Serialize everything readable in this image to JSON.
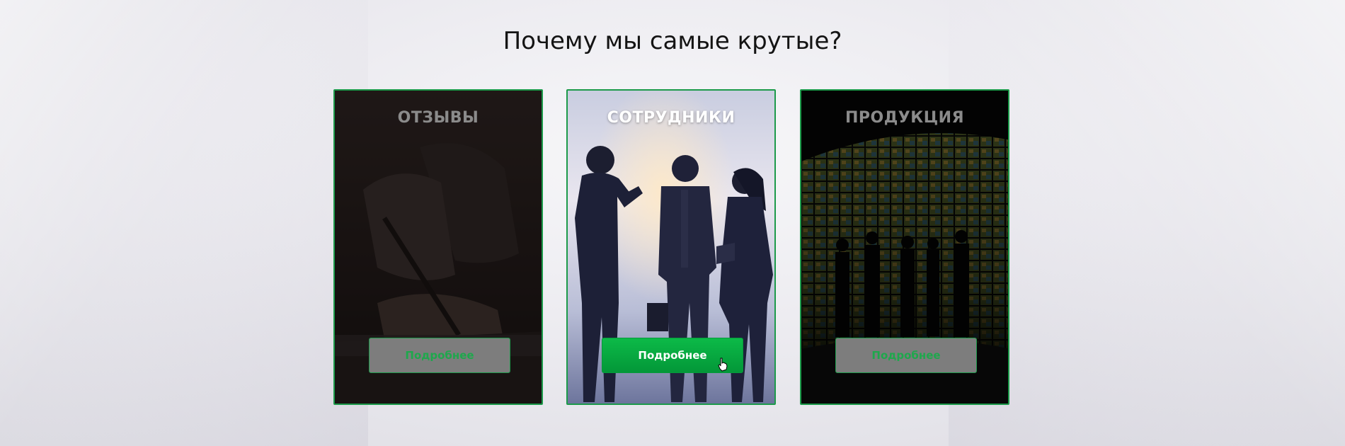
{
  "section": {
    "title": "Почему мы самые крутые?"
  },
  "cards": [
    {
      "title": "ОТЗЫВЫ",
      "button": "Подробнее",
      "image": "hand-writing-with-pen-photo",
      "state": "dimmed"
    },
    {
      "title": "СОТРУДНИКИ",
      "button": "Подробнее",
      "image": "business-team-silhouettes-photo",
      "state": "hover"
    },
    {
      "title": "ПРОДУКЦИЯ",
      "button": "Подробнее",
      "image": "video-wall-silhouettes-photo",
      "state": "dimmed"
    }
  ],
  "colors": {
    "accent": "#1c9a4a",
    "button_active": "#06a83f",
    "button_idle": "#7d7d7d"
  },
  "cursor": "hand-pointer-icon"
}
